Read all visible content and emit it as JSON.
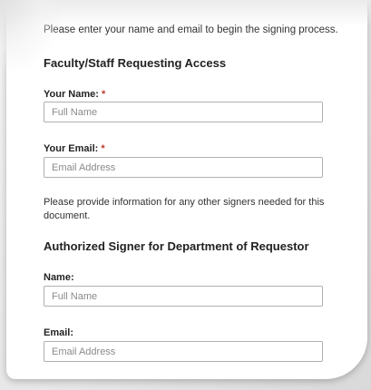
{
  "form": {
    "intro": "Please enter your name and email to begin the signing process.",
    "section1_heading": "Faculty/Staff Requesting Access",
    "your_name_label": "Your Name:",
    "your_name_placeholder": "Full Name",
    "your_email_label": "Your Email:",
    "your_email_placeholder": "Email Address",
    "required_marker": "*",
    "other_signers_text": "Please provide information for any other signers needed for this document.",
    "section2_heading": "Authorized Signer for Department of Requestor",
    "signer_name_label": "Name:",
    "signer_name_placeholder": "Full Name",
    "signer_email_label": "Email:",
    "signer_email_placeholder": "Email Address"
  },
  "colors": {
    "required": "#c0392b",
    "input_border": "#b0b0b0"
  }
}
